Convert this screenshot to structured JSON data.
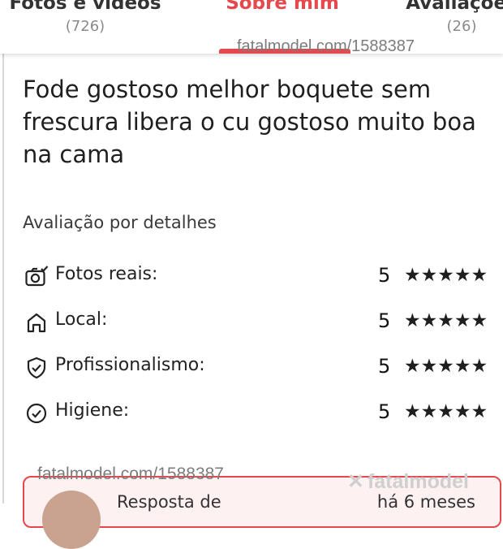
{
  "tabs": [
    {
      "label": "Fotos e vídeos",
      "count": "(726)"
    },
    {
      "label": "Sobre mim",
      "count": ""
    },
    {
      "label": "Avaliações",
      "count": "(26)"
    }
  ],
  "watermark": {
    "top": "fatalmodel.com/1588387",
    "bottom": "fatalmodel.com/1588387",
    "logo": "fatalmodel"
  },
  "review": {
    "text": "Fode gostoso melhor boquete sem frescura libera o cu gostoso muito boa na cama"
  },
  "details": {
    "title": "Avaliação por detalhes",
    "items": [
      {
        "label": "Fotos reais:",
        "score": "5",
        "stars": "★★★★★",
        "icon": "camera-check-icon"
      },
      {
        "label": "Local:",
        "score": "5",
        "stars": "★★★★★",
        "icon": "home-icon"
      },
      {
        "label": "Profissionalismo:",
        "score": "5",
        "stars": "★★★★★",
        "icon": "shield-check-icon"
      },
      {
        "label": "Higiene:",
        "score": "5",
        "stars": "★★★★★",
        "icon": "check-circle-icon"
      }
    ]
  },
  "reply": {
    "title": "Resposta de",
    "time": "há 6 meses"
  },
  "colors": {
    "accent": "#e5484d",
    "muted": "#8a8a8a"
  }
}
